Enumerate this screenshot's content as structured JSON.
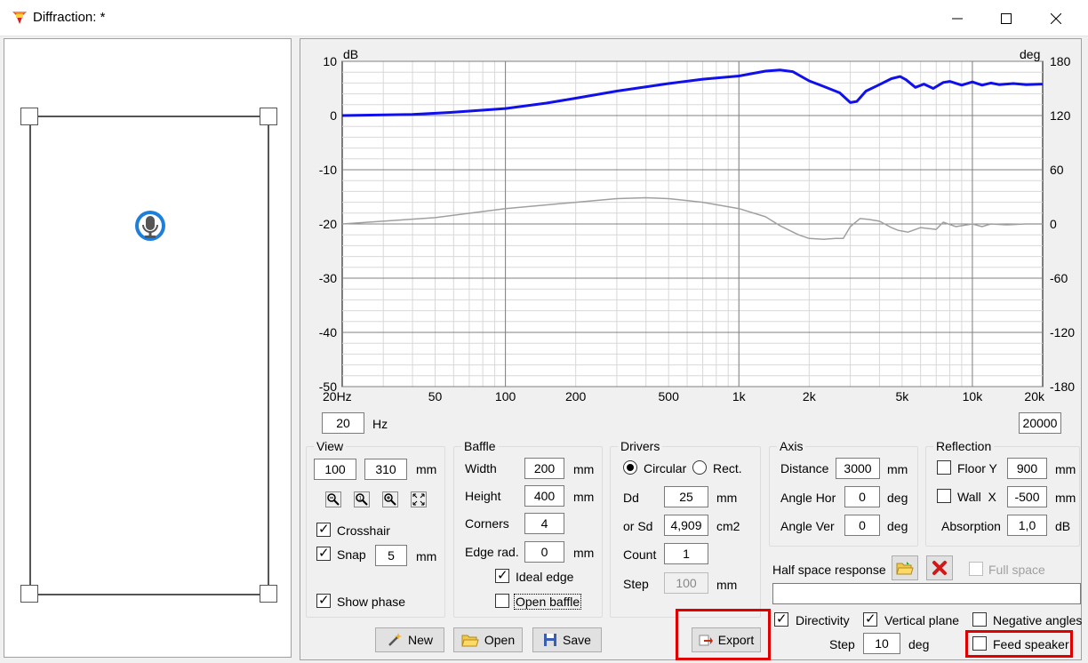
{
  "window": {
    "title": "Diffraction: *"
  },
  "chart_data": {
    "type": "line",
    "xscale": "log",
    "xlim": [
      20,
      20000
    ],
    "ylim": [
      -50,
      10
    ],
    "y2lim": [
      -180,
      180
    ],
    "ylabel": "dB",
    "y2label": "deg",
    "xticks": [
      {
        "v": 20,
        "label": "20Hz"
      },
      {
        "v": 50,
        "label": "50"
      },
      {
        "v": 100,
        "label": "100"
      },
      {
        "v": 200,
        "label": "200"
      },
      {
        "v": 500,
        "label": "500"
      },
      {
        "v": 1000,
        "label": "1k"
      },
      {
        "v": 2000,
        "label": "2k"
      },
      {
        "v": 5000,
        "label": "5k"
      },
      {
        "v": 10000,
        "label": "10k"
      },
      {
        "v": 20000,
        "label": "20k"
      }
    ],
    "yticks": [
      10,
      0,
      -10,
      -20,
      -30,
      -40,
      -50
    ],
    "y2ticks": [
      180,
      120,
      60,
      0,
      -60,
      -120,
      -180
    ],
    "grid": true,
    "series": [
      {
        "color": "#1010ee",
        "axis": "left",
        "x": [
          20,
          40,
          60,
          100,
          150,
          200,
          300,
          500,
          700,
          1000,
          1300,
          1500,
          1700,
          2000,
          2300,
          2700,
          3000,
          3200,
          3500,
          4000,
          4500,
          4900,
          5200,
          5700,
          6200,
          6800,
          7500,
          8000,
          9000,
          10000,
          11000,
          12000,
          13000,
          15000,
          17000,
          20000
        ],
        "y": [
          0,
          0.2,
          0.6,
          1.3,
          2.3,
          3.2,
          4.5,
          5.9,
          6.7,
          7.3,
          8.2,
          8.4,
          8.1,
          6.4,
          5.4,
          4.2,
          2.4,
          2.6,
          4.5,
          5.7,
          6.8,
          7.2,
          6.6,
          5.2,
          5.8,
          5.0,
          6.1,
          6.3,
          5.6,
          6.2,
          5.6,
          6.0,
          5.7,
          5.9,
          5.7,
          5.8
        ]
      },
      {
        "color": "#a0a0a0",
        "axis": "right",
        "x": [
          20,
          50,
          100,
          200,
          300,
          400,
          500,
          700,
          1000,
          1300,
          1500,
          1800,
          2000,
          2300,
          2600,
          2800,
          3000,
          3300,
          3600,
          4000,
          4500,
          4800,
          5300,
          6000,
          7000,
          7500,
          8500,
          10000,
          11000,
          12000,
          14000,
          17000,
          20000
        ],
        "y": [
          0,
          7,
          17,
          24,
          28,
          29,
          28,
          24,
          17,
          8,
          -2,
          -12,
          -16,
          -17,
          -16,
          -16,
          -3,
          6,
          5,
          3,
          -4,
          -7,
          -9,
          -4,
          -6,
          2,
          -3,
          0,
          -3,
          0,
          -1,
          0,
          0
        ]
      }
    ]
  },
  "range": {
    "min": "20",
    "min_unit": "Hz",
    "max": "20000"
  },
  "view": {
    "title": "View",
    "x": "100",
    "y": "310",
    "unit": "mm",
    "crosshair_label": "Crosshair",
    "crosshair": true,
    "snap_label": "Snap",
    "snap": true,
    "snap_value": "5",
    "snap_unit": "mm",
    "show_phase_label": "Show phase",
    "show_phase": true
  },
  "baffle": {
    "title": "Baffle",
    "width_label": "Width",
    "width": "200",
    "height_label": "Height",
    "height": "400",
    "corners_label": "Corners",
    "corners": "4",
    "edge_label": "Edge rad.",
    "edge": "0",
    "unit": "mm",
    "ideal_edge_label": "Ideal edge",
    "ideal_edge": true,
    "open_baffle_label": "Open baffle",
    "open_baffle": false
  },
  "drivers": {
    "title": "Drivers",
    "circular_label": "Circular",
    "rect_label": "Rect.",
    "dd_label": "Dd",
    "dd": "25",
    "dd_unit": "mm",
    "sd_label": "or Sd",
    "sd": "4,909",
    "sd_unit": "cm2",
    "count_label": "Count",
    "count": "1",
    "step_label": "Step",
    "step": "100",
    "step_unit": "mm"
  },
  "axis": {
    "title": "Axis",
    "distance_label": "Distance",
    "distance": "3000",
    "distance_unit": "mm",
    "hor_label": "Angle Hor",
    "hor": "0",
    "hor_unit": "deg",
    "ver_label": "Angle Ver",
    "ver": "0",
    "ver_unit": "deg"
  },
  "reflection": {
    "title": "Reflection",
    "floor_label": "Floor Y",
    "floor": "900",
    "floor_unit": "mm",
    "wall_label": "Wall  X",
    "wall": "-500",
    "wall_unit": "mm",
    "absorption_label": "Absorption",
    "absorption": "1,0",
    "absorption_unit": "dB"
  },
  "halfspace": {
    "label": "Half space response",
    "full_space_label": "Full space",
    "path": ""
  },
  "directivity": {
    "directivity_label": "Directivity",
    "vertical_label": "Vertical plane",
    "negative_label": "Negative angles",
    "step_label": "Step",
    "step": "10",
    "step_unit": "deg",
    "feed_label": "Feed speaker"
  },
  "buttons": {
    "new": "New",
    "open": "Open",
    "save": "Save",
    "export": "Export"
  }
}
